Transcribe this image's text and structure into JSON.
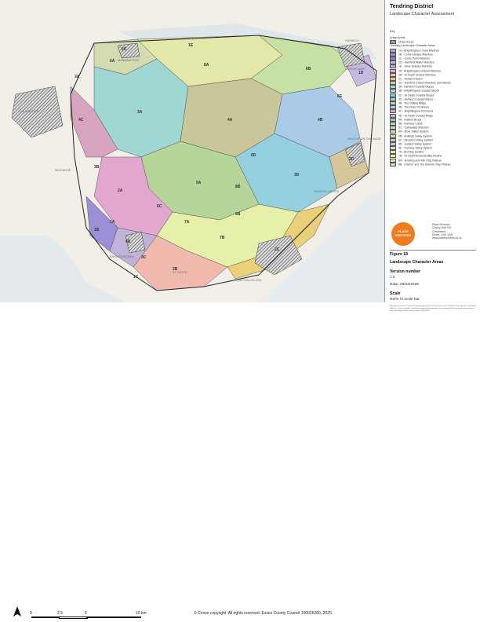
{
  "panel": {
    "title": "Tendring District",
    "subtitle": "Landscape Character Assessment",
    "key_label": "Key",
    "legend": [
      {
        "label": "Urban Areas",
        "type": "group"
      },
      {
        "label": "Urban Areas",
        "type": "item",
        "color": "#cfcfcf",
        "hatch": true
      },
      {
        "label": "Tendring Landscape Character Areas",
        "type": "group"
      },
      {
        "label": "1A - Brightlingsea Creek Marshes",
        "type": "item",
        "color": "#b9a3cf"
      },
      {
        "label": "1B - Colne Estuary Marshes",
        "type": "item",
        "color": "#9d8fd6"
      },
      {
        "label": "1C - Colne Point Marshes",
        "type": "item",
        "color": "#8f86c2"
      },
      {
        "label": "1D - Hamford Water Marshes",
        "type": "item",
        "color": "#c7b9e2"
      },
      {
        "label": "1E - Stour Estuary Marshes",
        "type": "item",
        "color": "#bfaed6"
      },
      {
        "label": "2A - Brightlingsea Grazed Marshes",
        "type": "item",
        "color": "#e3a6cf"
      },
      {
        "label": "2B - St Osyth Grazed Marshes",
        "type": "item",
        "color": "#f2b9ae"
      },
      {
        "label": "2C - Holland Haven",
        "type": "item",
        "color": "#ead07a"
      },
      {
        "label": "2D - Hamford Grazed Marshes and Islands",
        "type": "item",
        "color": "#d6c79b"
      },
      {
        "label": "3A - Hamford Coastal Slopes",
        "type": "item",
        "color": "#9fd7d3"
      },
      {
        "label": "3B - Brightlingsea Coastal Slopes",
        "type": "item",
        "color": "#a7d8c0"
      },
      {
        "label": "3C - St Osyth Coastal Slopes",
        "type": "item",
        "color": "#7fcfc1"
      },
      {
        "label": "3D - Holland Coastal Slopes",
        "type": "item",
        "color": "#95d0e0"
      },
      {
        "label": "4A - The Oakley Ridge",
        "type": "item",
        "color": "#c9c79a"
      },
      {
        "label": "4B - The Naze Peninsula",
        "type": "item",
        "color": "#a9cbe8"
      },
      {
        "label": "4C - Brightlingsea Peninsula",
        "type": "item",
        "color": "#d7a5c0"
      },
      {
        "label": "4D - St Osyth Coastal Ridge",
        "type": "item",
        "color": "#c0b2d8"
      },
      {
        "label": "5A - Holland Brook",
        "type": "item",
        "color": "#8fcfb4"
      },
      {
        "label": "5B - Ramsey Creek",
        "type": "item",
        "color": "#b5d59a"
      },
      {
        "label": "5C - Cattawade Marshes",
        "type": "item",
        "color": "#c2ddb0"
      },
      {
        "label": "6A - Stour Valley System",
        "type": "item",
        "color": "#d2dcb0"
      },
      {
        "label": "6B - Ardleigh Valley System",
        "type": "item",
        "color": "#c7e0a6"
      },
      {
        "label": "6C - Alresford Valley System",
        "type": "item",
        "color": "#a9d2b9"
      },
      {
        "label": "6D - Holland Valley System",
        "type": "item",
        "color": "#b7cfd9"
      },
      {
        "label": "6E - Ramsey Valley System",
        "type": "item",
        "color": "#cde2bd"
      },
      {
        "label": "7A - Bromley Heaths",
        "type": "item",
        "color": "#dceda5"
      },
      {
        "label": "7B - St Osyth/Great Bentley Heaths",
        "type": "item",
        "color": "#e6f0a9"
      },
      {
        "label": "8A - Tendring and Wix Clay Plateau",
        "type": "item",
        "color": "#e3e7a9"
      },
      {
        "label": "8B - Clacton and The Sokens Clay Plateau",
        "type": "item",
        "color": "#bcdcc9"
      }
    ],
    "logo_text": "PLACE SERVICES",
    "address": "Place Services\nCounty Hall, EA\nChelmsford\nEssex, CM1 1QH\nwww.placeservices.co.uk",
    "figure_label": "Figure 18",
    "figure_value": "Landscape Character Areas",
    "version_label": "Version number",
    "version_value": "1.0",
    "date_value": "Date: 29/03/2026",
    "scale_label": "Scale",
    "scale_value": "Refer to scale bar",
    "notice": "Reproduced from the Ordnance Survey mapping with the permission of the Controller of Her Majesty's Stationery Office (c) Crown copyright. Unauthorised reproduction infringes Crown copyright and may lead to prosecution or civil proceedings. Essex County Council 100019602."
  },
  "map": {
    "scale_ticks": [
      "0",
      "2.5",
      "5",
      "10 km"
    ],
    "copyright": "© Crown copyright. All rights reserved. Essex County Council 100026260, 2025",
    "towns": [
      {
        "label": "COLCHESTER"
      },
      {
        "label": "MANNINGTREE"
      },
      {
        "label": "HARWICH"
      },
      {
        "label": "DOVERCOURT"
      },
      {
        "label": "FRINTON-ON-SEA"
      },
      {
        "label": "WALTON-ON-THE-NAZE"
      },
      {
        "label": "CLACTON-ON-SEA"
      },
      {
        "label": "BRIGHTLINGSEA"
      },
      {
        "label": "WIVENHOE"
      },
      {
        "label": "ST OSYTH"
      }
    ],
    "areas": [
      "5C",
      "1E",
      "6A",
      "8A",
      "6B",
      "3A",
      "4A",
      "2D",
      "1D",
      "3D",
      "4B",
      "2C",
      "8B",
      "6D",
      "5A",
      "7B",
      "6C",
      "1A",
      "2A",
      "4C",
      "3B",
      "2B",
      "1B",
      "1C",
      "3C",
      "4D",
      "7A",
      "5B",
      "6E",
      "3A"
    ]
  }
}
